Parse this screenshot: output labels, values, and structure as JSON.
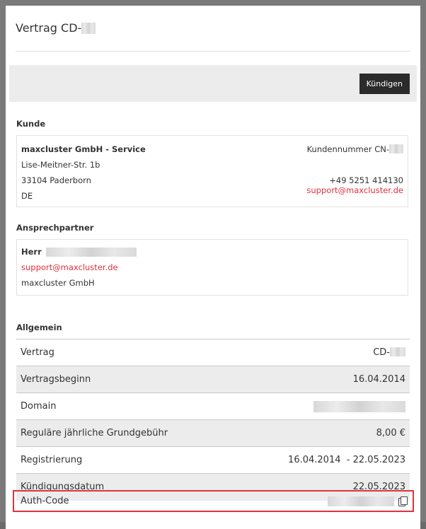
{
  "modal": {
    "title_prefix": "Vertrag CD-",
    "cancel_button": "Kündigen"
  },
  "customer": {
    "section_title": "Kunde",
    "company": "maxcluster GmbH - Service",
    "street": "Lise-Meitner-Str. 1b",
    "city": "33104 Paderborn",
    "country": "DE",
    "customer_number_prefix": "Kundennummer CN-",
    "phone": "+49 5251 414130",
    "email": "support@maxcluster.de"
  },
  "contact": {
    "section_title": "Ansprechpartner",
    "salutation": "Herr",
    "email": "support@maxcluster.de",
    "company": "maxcluster GmbH"
  },
  "general": {
    "section_title": "Allgemein",
    "rows": [
      {
        "label": "Vertrag",
        "value": "CD-"
      },
      {
        "label": "Vertragsbeginn",
        "value": "16.04.2014"
      },
      {
        "label": "Domain",
        "value": ""
      },
      {
        "label": "Reguläre jährliche Grundgebühr",
        "value": "8,00 €"
      },
      {
        "label": "Registrierung",
        "value": "16.04.2014  - 22.05.2023"
      },
      {
        "label": "Kündigungsdatum",
        "value": "22.05.2023"
      }
    ],
    "auth_code_label": "Auth-Code"
  },
  "icons": {
    "copy": "copy-icon"
  },
  "colors": {
    "accent": "#e0323d",
    "button": "#2b2b2b"
  }
}
